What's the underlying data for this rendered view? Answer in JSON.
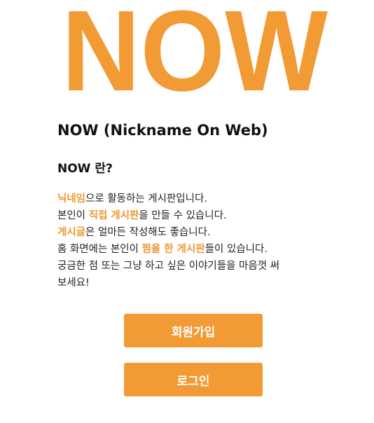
{
  "logo": {
    "text": "NOW",
    "color": "#f29a34"
  },
  "header": {
    "title": "NOW (Nickname On Web)",
    "subtitle": "NOW 란?"
  },
  "description": {
    "line1": {
      "hl1": "닉네임",
      "rest": "으로 활동하는 게시판입니다."
    },
    "line2": {
      "pre": "본인이 ",
      "hl1": "직접 게시판",
      "rest": "을 만들 수 있습니다."
    },
    "line3": {
      "hl1": "게시글",
      "rest": "은 얼마든 작성해도 좋습니다."
    },
    "line4": {
      "pre": "홈 화면에는 본인이 ",
      "hl1": "찜을 한 게시판",
      "rest": "들이 있습니다."
    },
    "line5": "궁금한 점 또는 그냥 하고 싶은 이야기들을 마음껏 써",
    "line6": "보세요!"
  },
  "actions": {
    "signup_label": "회원가입",
    "login_label": "로그인"
  },
  "colors": {
    "accent": "#f29a34",
    "highlight_text": "#f0962f"
  }
}
